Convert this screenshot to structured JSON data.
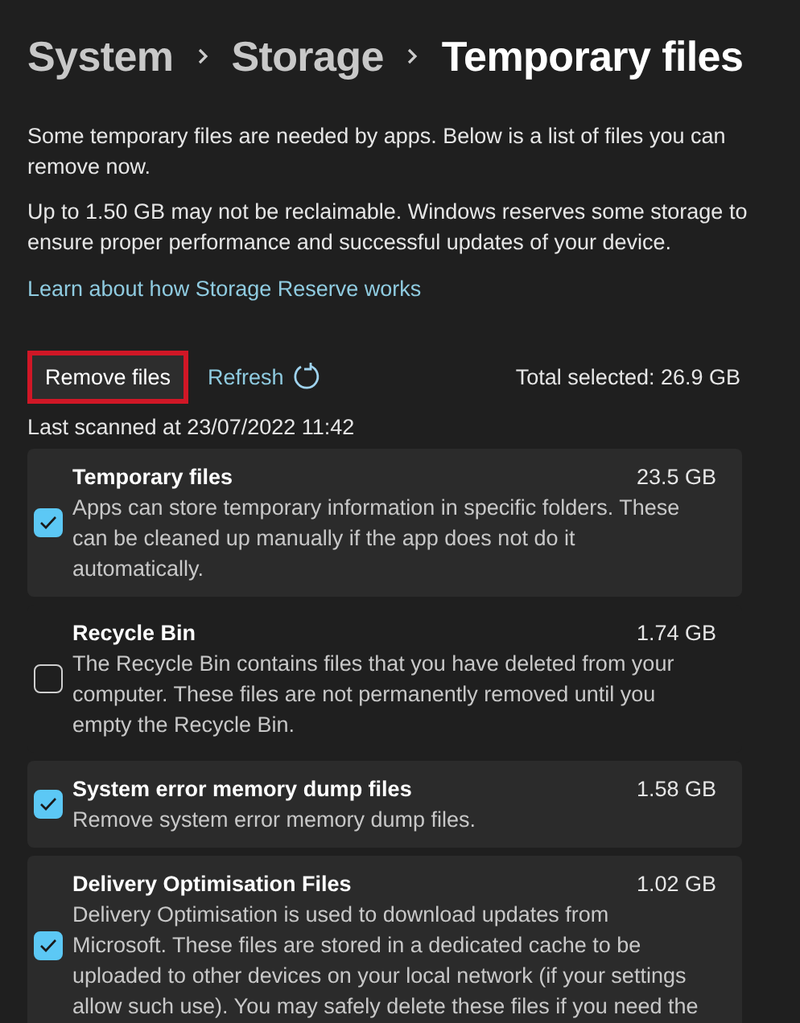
{
  "breadcrumb": {
    "items": [
      "System",
      "Storage"
    ],
    "current": "Temporary files"
  },
  "intro": "Some temporary files are needed by apps. Below is a list of files you can remove now.",
  "reserve_note": "Up to 1.50 GB may not be reclaimable. Windows reserves some storage to ensure proper performance and successful updates of your device.",
  "learn_link": "Learn about how Storage Reserve works",
  "actions": {
    "remove_button": "Remove files",
    "refresh_link": "Refresh",
    "total_selected": "Total selected: 26.9 GB"
  },
  "last_scanned": "Last scanned at 23/07/2022 11:42",
  "file_types": [
    {
      "name": "Temporary files",
      "size": "23.5 GB",
      "description": "Apps can store temporary information in specific folders. These can be cleaned up manually if the app does not do it automatically.",
      "checked": true
    },
    {
      "name": "Recycle Bin",
      "size": "1.74 GB",
      "description": "The Recycle Bin contains files that you have deleted from your computer. These files are not permanently removed until you empty the Recycle Bin.",
      "checked": false
    },
    {
      "name": "System error memory dump files",
      "size": "1.58 GB",
      "description": "Remove system error memory dump files.",
      "checked": true
    },
    {
      "name": "Delivery Optimisation Files",
      "size": "1.02 GB",
      "description": "Delivery Optimisation is used to download updates from Microsoft. These files are stored in a dedicated cache to be uploaded to other devices on your local network (if your settings allow such use). You may safely delete these files if you need the",
      "checked": true
    }
  ]
}
